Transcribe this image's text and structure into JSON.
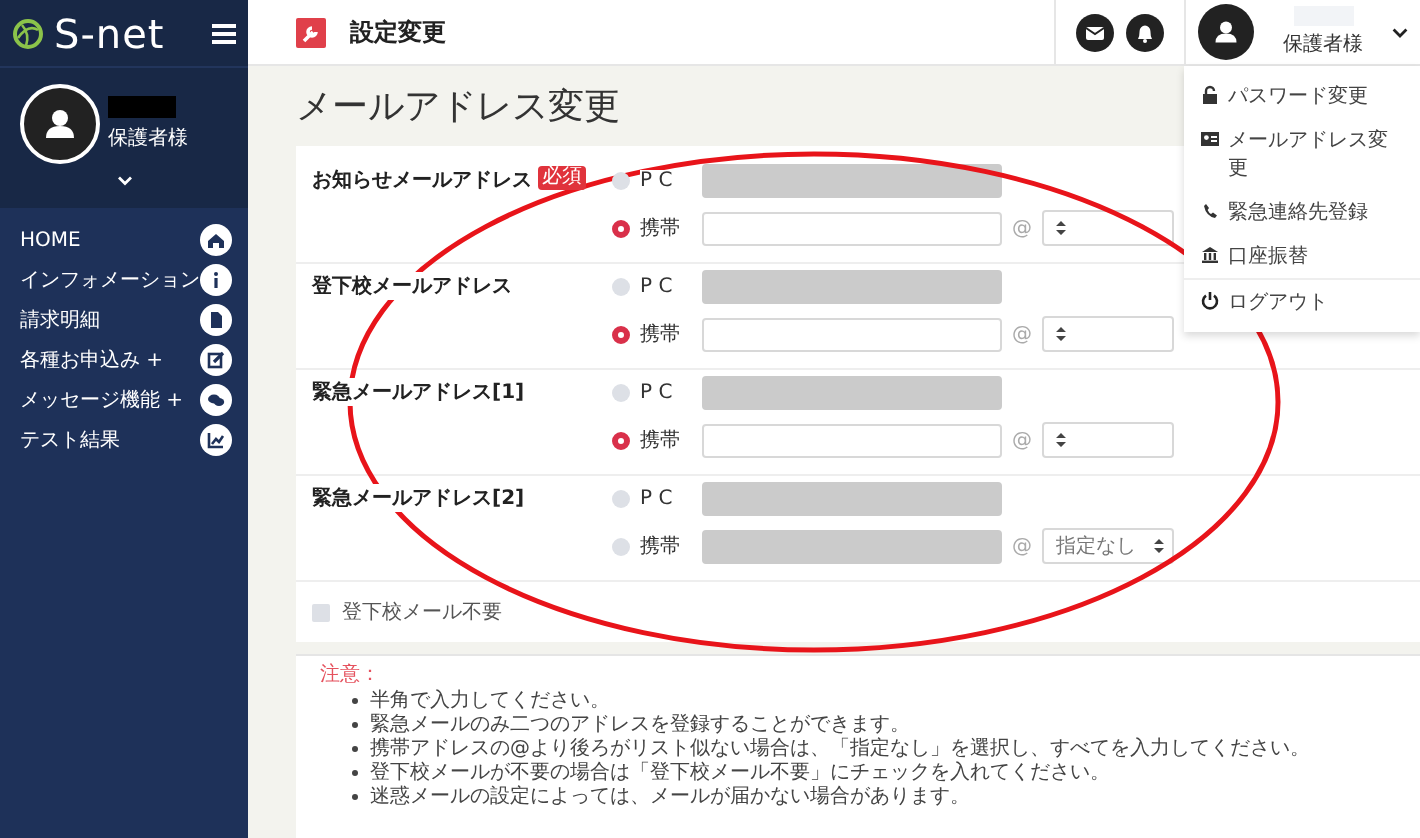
{
  "sidebar": {
    "logo": "S-net",
    "user_role": "保護者様",
    "items": [
      {
        "label": "HOME"
      },
      {
        "label": "インフォメーション"
      },
      {
        "label": "請求明細"
      },
      {
        "label": "各種お申込み +"
      },
      {
        "label": "メッセージ機能 +"
      },
      {
        "label": "テスト結果"
      }
    ]
  },
  "header": {
    "title": "設定変更",
    "user_role": "保護者様"
  },
  "user_menu": {
    "items": [
      {
        "label": "パスワード変更"
      },
      {
        "label": "メールアドレス変更"
      },
      {
        "label": "緊急連絡先登録"
      },
      {
        "label": "口座振替"
      },
      {
        "label": "ログアウト"
      }
    ]
  },
  "page_title": "メールアドレス変更",
  "sections": [
    {
      "label": "お知らせメールアドレス",
      "required_badge": "必須",
      "options": [
        {
          "kind": "pc",
          "label": "P C",
          "selected": false
        },
        {
          "kind": "mobile",
          "label": "携帯",
          "selected": true,
          "at": "@"
        }
      ]
    },
    {
      "label": "登下校メールアドレス",
      "options": [
        {
          "kind": "pc",
          "label": "P C",
          "selected": false
        },
        {
          "kind": "mobile",
          "label": "携帯",
          "selected": true,
          "at": "@"
        }
      ]
    },
    {
      "label": "緊急メールアドレス[1]",
      "options": [
        {
          "kind": "pc",
          "label": "P C",
          "selected": false
        },
        {
          "kind": "mobile",
          "label": "携帯",
          "selected": true,
          "at": "@"
        }
      ]
    },
    {
      "label": "緊急メールアドレス[2]",
      "options": [
        {
          "kind": "pc",
          "label": "P C",
          "selected": false
        },
        {
          "kind": "mobile",
          "label": "携帯",
          "selected": false,
          "at": "@",
          "domain": "指定なし"
        }
      ]
    }
  ],
  "opt_out": {
    "label": "登下校メール不要",
    "checked": false
  },
  "notes": {
    "heading": "注意：",
    "items": [
      "半角で入力してください。",
      "緊急メールのみ二つのアドレスを登録することができます。",
      "携帯アドレスの@より後ろがリスト似ない場合は、「指定なし」を選択し、すべてを入力してください。",
      "登下校メールが不要の場合は「登下校メール不要」にチェックを入れてください。",
      "迷惑メールの設定によっては、メールが届かない場合があります。"
    ]
  }
}
